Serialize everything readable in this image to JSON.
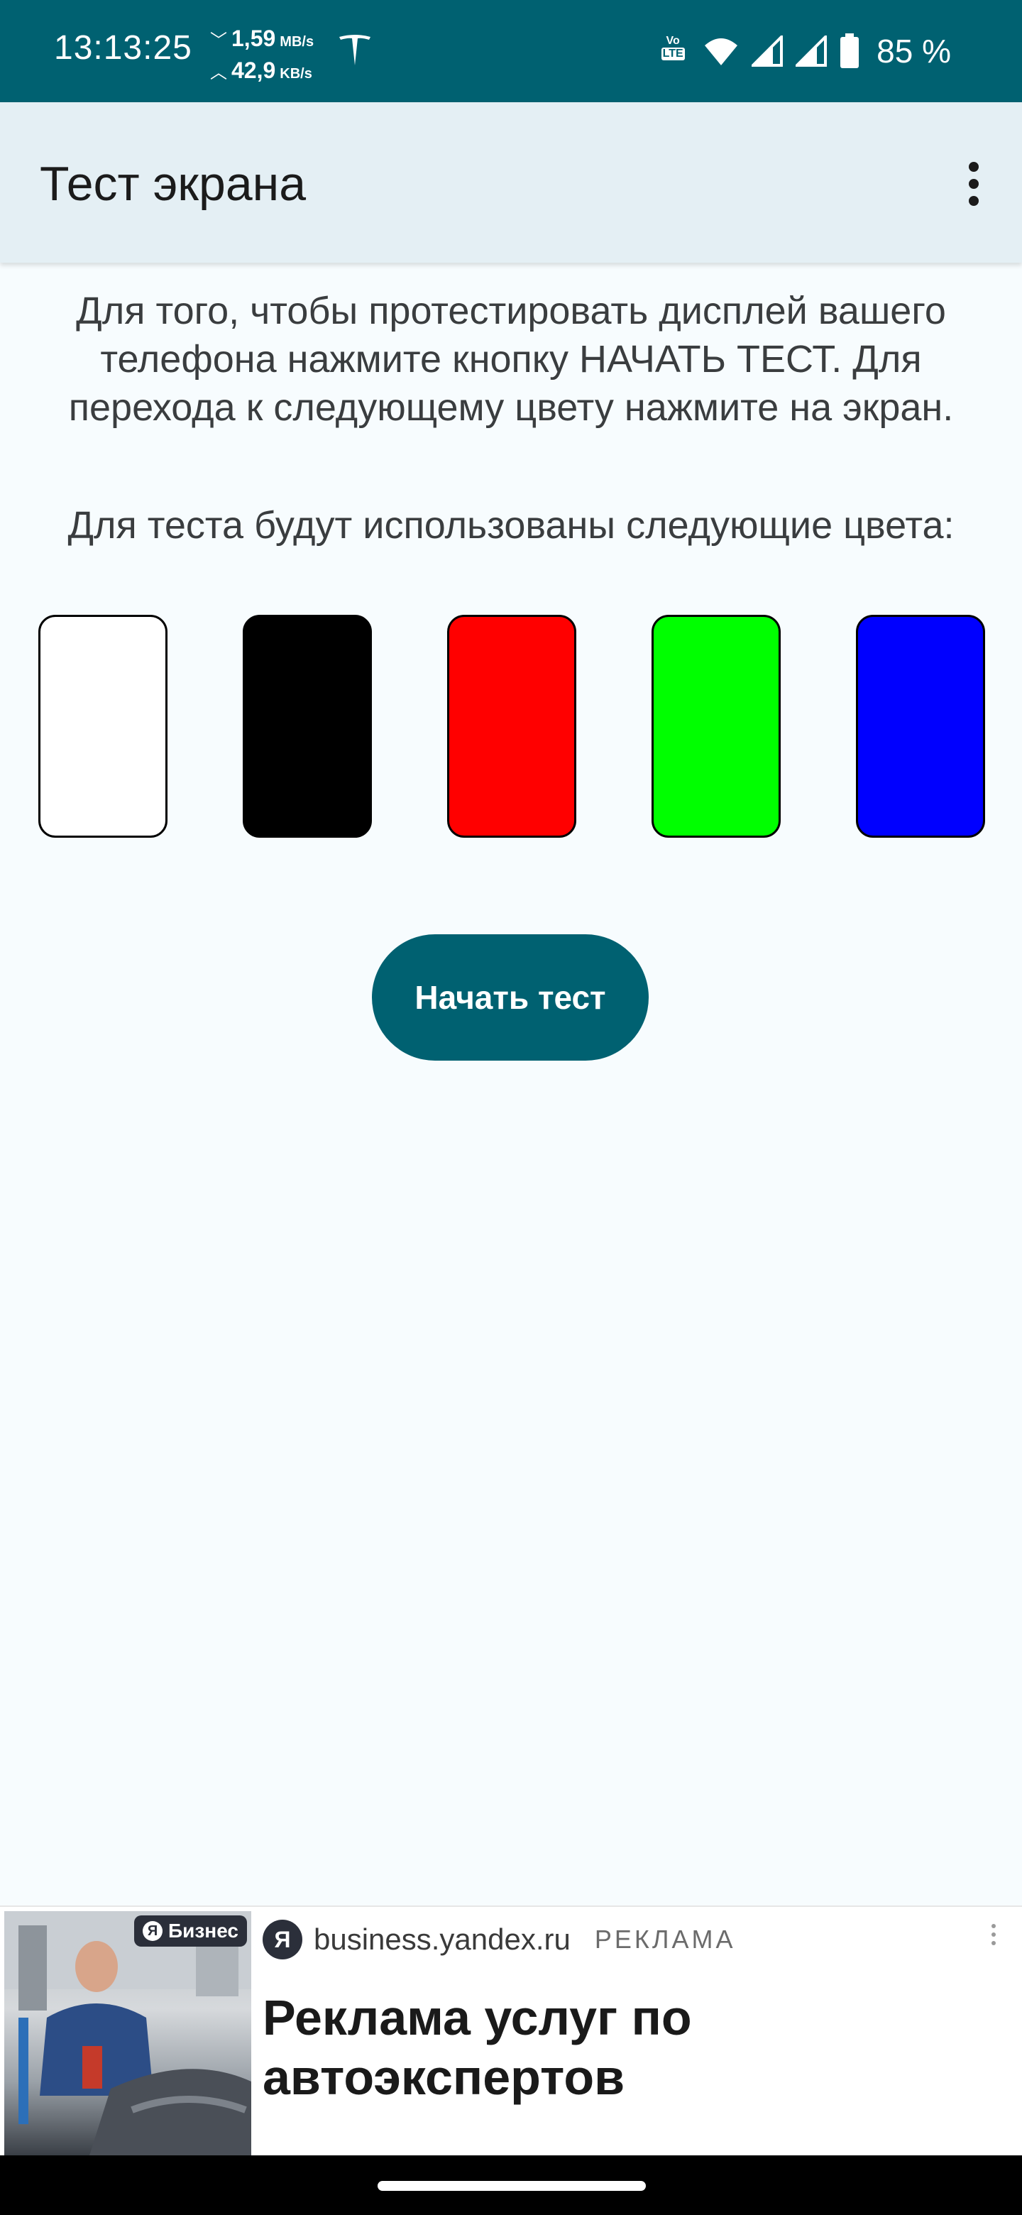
{
  "status_bar": {
    "time": "13:13:25",
    "download_speed": "1,59",
    "download_unit": "MB/s",
    "upload_speed": "42,9",
    "upload_unit": "KB/s",
    "volte_top": "Vo",
    "volte_bottom": "LTE",
    "battery_percent": "85 %",
    "icons": [
      "tesla-icon",
      "wifi-icon",
      "signal-icon",
      "signal-icon",
      "battery-icon"
    ]
  },
  "app_bar": {
    "title": "Тест экрана",
    "menu_icon": "more-vert-icon"
  },
  "main": {
    "description": "Для того, чтобы протестировать дисплей вашего телефона нажмите кнопку НАЧАТЬ ТЕСТ. Для перехода к следующему цвету нажмите на экран.",
    "colors_label": "Для теста будут использованы следующие цвета:",
    "colors": [
      "#ffffff",
      "#000000",
      "#ff0000",
      "#00ff00",
      "#0000ff"
    ],
    "start_button": "Начать тест"
  },
  "ad": {
    "badge_logo": "Я",
    "badge_text": "Бизнес",
    "logo": "Я",
    "domain": "business.yandex.ru",
    "label": "РЕКЛАМА",
    "headline": "Реклама услуг по автоэкспертов"
  },
  "colors": {
    "accent": "#006171",
    "app_bar": "#e4eff4",
    "background": "#f7fcfe"
  }
}
